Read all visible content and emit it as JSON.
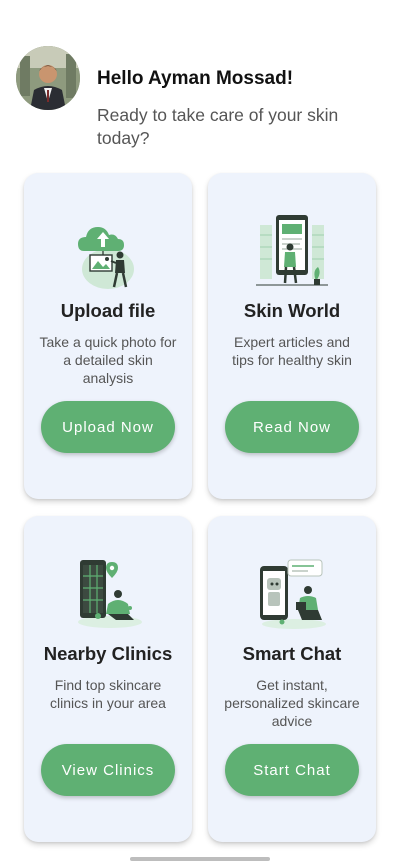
{
  "user": {
    "greeting": "Hello Ayman Mossad!",
    "subtitle": "Ready to take care of your skin today?"
  },
  "cards": [
    {
      "title": "Upload file",
      "description": "Take a quick photo for a detailed skin analysis",
      "button": "Upload Now",
      "icon": "upload-photo-illustration"
    },
    {
      "title": "Skin World",
      "description": "Expert articles and tips for healthy skin",
      "button": "Read Now",
      "icon": "articles-tablet-illustration"
    },
    {
      "title": "Nearby Clinics",
      "description": "Find top skincare clinics in your area",
      "button": "View Clinics",
      "icon": "clinics-map-illustration"
    },
    {
      "title": "Smart Chat",
      "description": "Get instant, personalized skincare advice",
      "button": "Start Chat",
      "icon": "chatbot-illustration"
    }
  ],
  "colors": {
    "accent": "#5fb073",
    "card_bg": "#eef3fc",
    "background": "#ffffff"
  }
}
